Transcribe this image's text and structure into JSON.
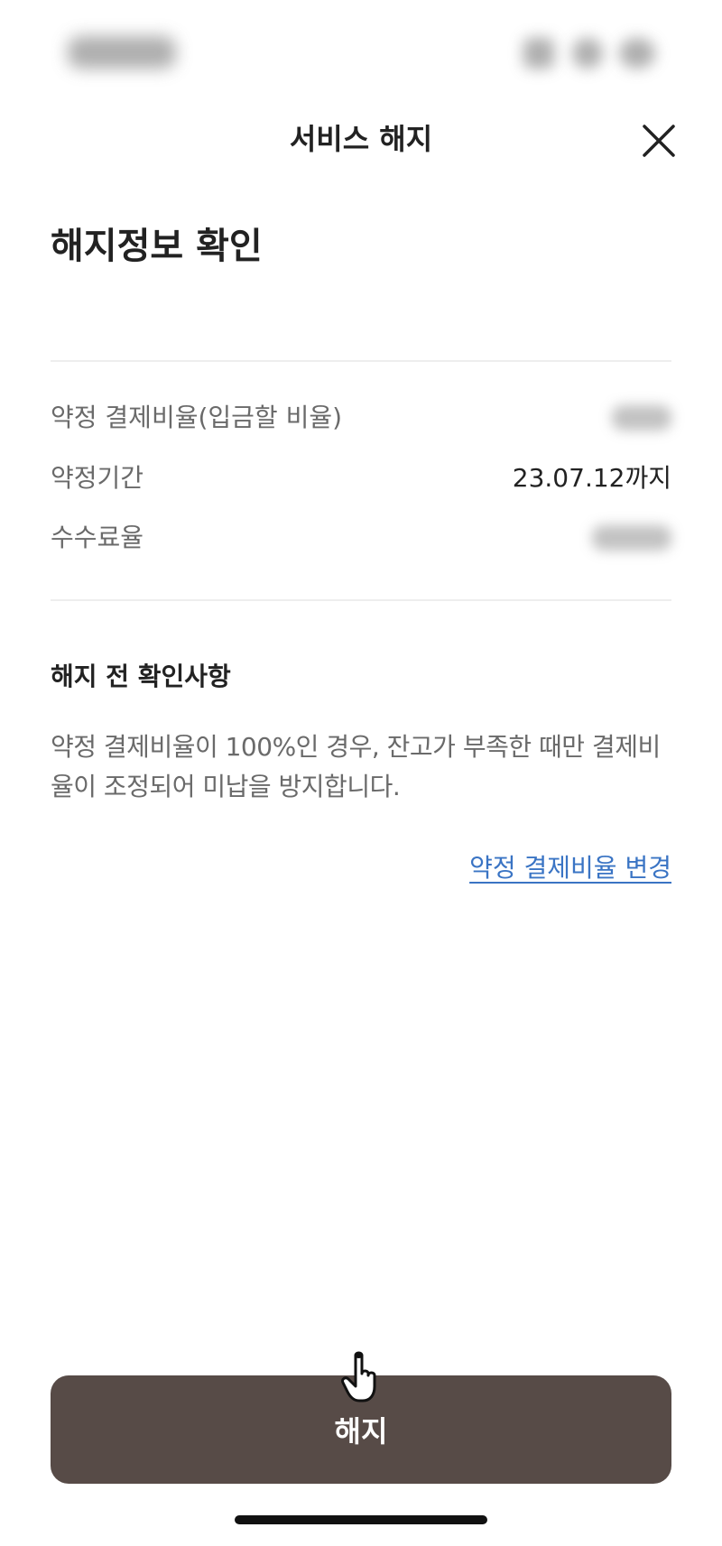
{
  "nav": {
    "title": "서비스 해지",
    "close_icon": "close-icon"
  },
  "heading": "해지정보 확인",
  "info": {
    "rows": [
      {
        "label": "약정 결제비율(입금할 비율)",
        "value": null,
        "value_blurred": true
      },
      {
        "label": "약정기간",
        "value": "23.07.12까지",
        "value_blurred": false
      },
      {
        "label": "수수료율",
        "value": null,
        "value_blurred": true
      }
    ]
  },
  "notice": {
    "title": "해지 전 확인사항",
    "text": "약정 결제비율이 100%인 경우, 잔고가 부족한 때만 결제비율이 조정되어 미납을 방지합니다."
  },
  "change_link": "약정 결제비율 변경",
  "cancel_button": "해지",
  "colors": {
    "primary_button": "#574b47",
    "link": "#3a74c4",
    "label": "#6a6a6a",
    "text": "#222222",
    "divider": "#eeeeee"
  },
  "icons": {
    "close": "close-icon",
    "pointer": "hand-pointer-icon"
  }
}
